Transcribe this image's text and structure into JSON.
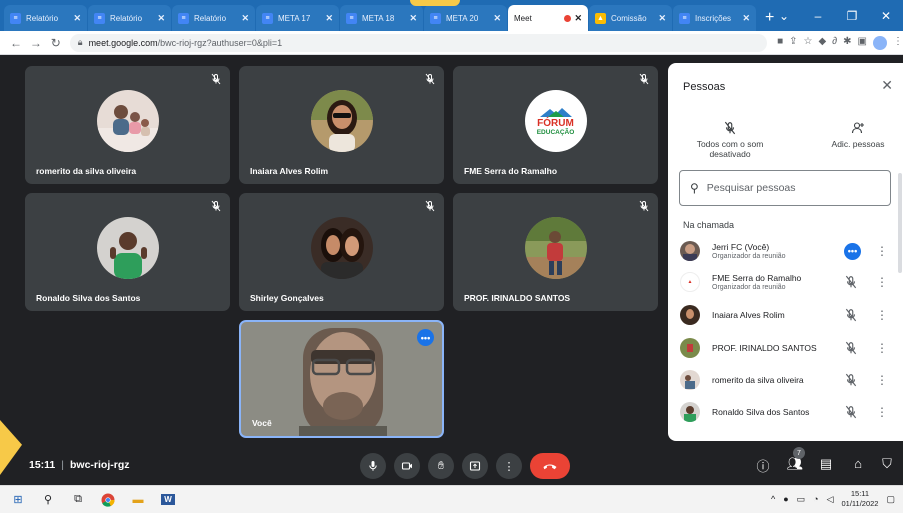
{
  "browser": {
    "tabs": [
      {
        "title": "Relatório",
        "icon": "docs-icon"
      },
      {
        "title": "Relatório",
        "icon": "docs-icon"
      },
      {
        "title": "Relatório",
        "icon": "docs-icon"
      },
      {
        "title": "META 17",
        "icon": "docs-icon"
      },
      {
        "title": "META 18",
        "icon": "docs-icon"
      },
      {
        "title": "META 20",
        "icon": "docs-icon"
      },
      {
        "title": "Meet",
        "icon": "meet-icon"
      },
      {
        "title": "Comissão",
        "icon": "drive-icon"
      },
      {
        "title": "Inscrições",
        "icon": "docs-icon"
      }
    ],
    "new_tab": "+",
    "url_host": "meet.google.com",
    "url_path": "/bwc-rioj-rgz?authuser=0&pli=1"
  },
  "meet": {
    "tiles": [
      {
        "name": "romerito da silva oliveira"
      },
      {
        "name": "Inaiara Alves Rolim"
      },
      {
        "name": "FME Serra do Ramalho",
        "logo_line1": "FÓRUM",
        "logo_line2": "EDUCAÇÃO"
      },
      {
        "name": "Ronaldo Silva dos Santos"
      },
      {
        "name": "Shirley Gonçalves"
      },
      {
        "name": "PROF. IRINALDO SANTOS"
      }
    ],
    "self_tile": {
      "name": "Você"
    },
    "time": "15:11",
    "separator": "|",
    "meeting_code": "bwc-rioj-rgz",
    "participant_count": "7"
  },
  "people_panel": {
    "title": "Pessoas",
    "mute_all_label": "Todos com o som desativado",
    "add_people_label": "Adic. pessoas",
    "search_placeholder": "Pesquisar pessoas",
    "section_label": "Na chamada",
    "participants": [
      {
        "name": "Jerri FC (Você)",
        "role": "Organizador da reunião"
      },
      {
        "name": "FME Serra do Ramalho",
        "role": "Organizador da reunião"
      },
      {
        "name": "Inaiara Alves Rolim",
        "role": ""
      },
      {
        "name": "PROF. IRINALDO SANTOS",
        "role": ""
      },
      {
        "name": "romerito da silva oliveira",
        "role": ""
      },
      {
        "name": "Ronaldo Silva dos Santos",
        "role": ""
      }
    ]
  },
  "taskbar": {
    "time": "15:11",
    "date": "01/11/2022"
  },
  "colors": {
    "accent": "#1a73e8",
    "end_call": "#ea4335",
    "tile_bg": "#3c4043"
  }
}
